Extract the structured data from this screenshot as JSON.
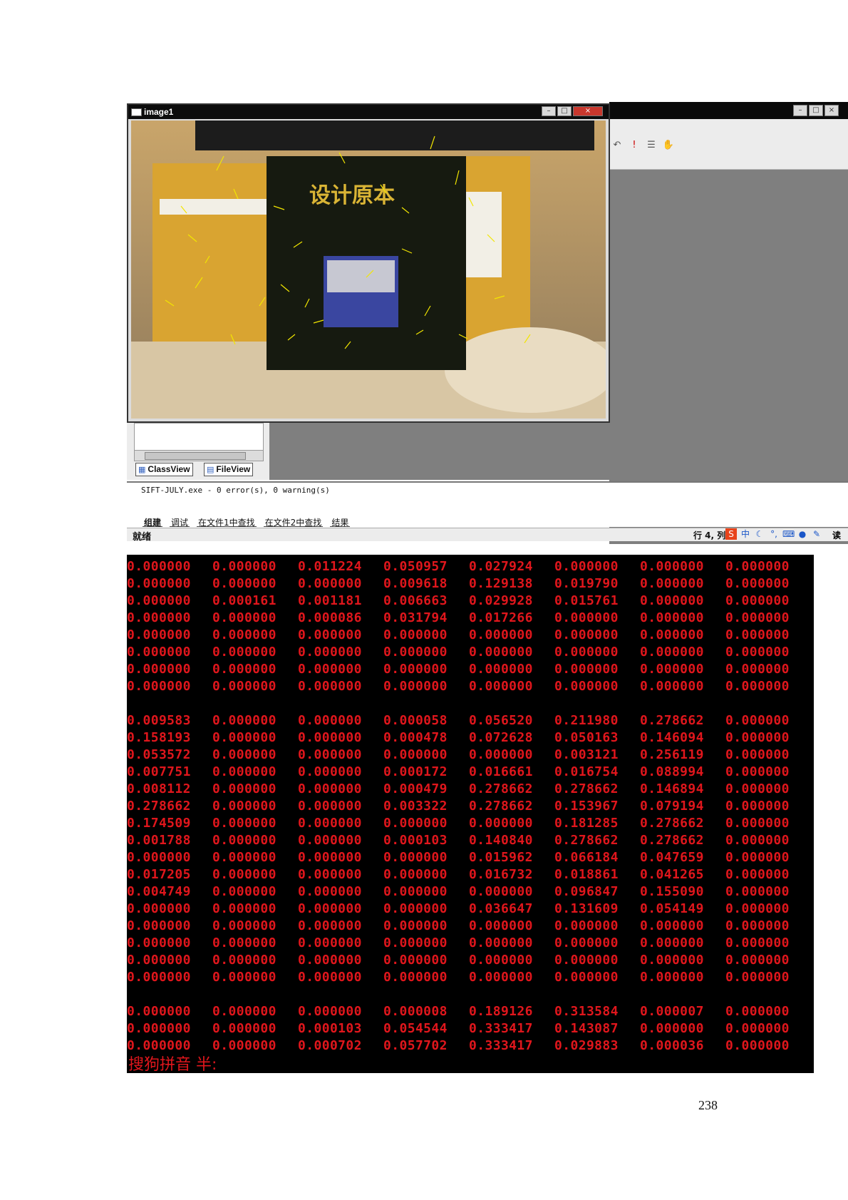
{
  "image_window": {
    "title": "image1"
  },
  "ide_window": {
    "toolbar_icons": [
      "undo-icon",
      "execute-icon",
      "list-icon",
      "hand-icon"
    ]
  },
  "workspace": {
    "tabs": [
      "ClassView",
      "FileView"
    ],
    "scroll_label": "III"
  },
  "output": {
    "text": "SIFT-JULY.exe - 0 error(s), 0 warning(s)",
    "tabs": [
      "组建",
      "调试",
      "在文件1中查找",
      "在文件2中查找",
      "结果"
    ]
  },
  "status": {
    "left": "就绪",
    "position": "行 4, 列",
    "right": "读"
  },
  "console": {
    "rows": [
      [
        "0.000000",
        "0.000000",
        "0.011224",
        "0.050957",
        "0.027924",
        "0.000000",
        "0.000000",
        "0.000000"
      ],
      [
        "0.000000",
        "0.000000",
        "0.000000",
        "0.009618",
        "0.129138",
        "0.019790",
        "0.000000",
        "0.000000"
      ],
      [
        "0.000000",
        "0.000161",
        "0.001181",
        "0.006663",
        "0.029928",
        "0.015761",
        "0.000000",
        "0.000000"
      ],
      [
        "0.000000",
        "0.000000",
        "0.000086",
        "0.031794",
        "0.017266",
        "0.000000",
        "0.000000",
        "0.000000"
      ],
      [
        "0.000000",
        "0.000000",
        "0.000000",
        "0.000000",
        "0.000000",
        "0.000000",
        "0.000000",
        "0.000000"
      ],
      [
        "0.000000",
        "0.000000",
        "0.000000",
        "0.000000",
        "0.000000",
        "0.000000",
        "0.000000",
        "0.000000"
      ],
      [
        "0.000000",
        "0.000000",
        "0.000000",
        "0.000000",
        "0.000000",
        "0.000000",
        "0.000000",
        "0.000000"
      ],
      [
        "0.000000",
        "0.000000",
        "0.000000",
        "0.000000",
        "0.000000",
        "0.000000",
        "0.000000",
        "0.000000"
      ],
      [],
      [
        "0.009583",
        "0.000000",
        "0.000000",
        "0.000058",
        "0.056520",
        "0.211980",
        "0.278662",
        "0.000000"
      ],
      [
        "0.158193",
        "0.000000",
        "0.000000",
        "0.000478",
        "0.072628",
        "0.050163",
        "0.146094",
        "0.000000"
      ],
      [
        "0.053572",
        "0.000000",
        "0.000000",
        "0.000000",
        "0.000000",
        "0.003121",
        "0.256119",
        "0.000000"
      ],
      [
        "0.007751",
        "0.000000",
        "0.000000",
        "0.000172",
        "0.016661",
        "0.016754",
        "0.088994",
        "0.000000"
      ],
      [
        "0.008112",
        "0.000000",
        "0.000000",
        "0.000479",
        "0.278662",
        "0.278662",
        "0.146894",
        "0.000000"
      ],
      [
        "0.278662",
        "0.000000",
        "0.000000",
        "0.003322",
        "0.278662",
        "0.153967",
        "0.079194",
        "0.000000"
      ],
      [
        "0.174509",
        "0.000000",
        "0.000000",
        "0.000000",
        "0.000000",
        "0.181285",
        "0.278662",
        "0.000000"
      ],
      [
        "0.001788",
        "0.000000",
        "0.000000",
        "0.000103",
        "0.140840",
        "0.278662",
        "0.278662",
        "0.000000"
      ],
      [
        "0.000000",
        "0.000000",
        "0.000000",
        "0.000000",
        "0.015962",
        "0.066184",
        "0.047659",
        "0.000000"
      ],
      [
        "0.017205",
        "0.000000",
        "0.000000",
        "0.000000",
        "0.016732",
        "0.018861",
        "0.041265",
        "0.000000"
      ],
      [
        "0.004749",
        "0.000000",
        "0.000000",
        "0.000000",
        "0.000000",
        "0.096847",
        "0.155090",
        "0.000000"
      ],
      [
        "0.000000",
        "0.000000",
        "0.000000",
        "0.000000",
        "0.036647",
        "0.131609",
        "0.054149",
        "0.000000"
      ],
      [
        "0.000000",
        "0.000000",
        "0.000000",
        "0.000000",
        "0.000000",
        "0.000000",
        "0.000000",
        "0.000000"
      ],
      [
        "0.000000",
        "0.000000",
        "0.000000",
        "0.000000",
        "0.000000",
        "0.000000",
        "0.000000",
        "0.000000"
      ],
      [
        "0.000000",
        "0.000000",
        "0.000000",
        "0.000000",
        "0.000000",
        "0.000000",
        "0.000000",
        "0.000000"
      ],
      [
        "0.000000",
        "0.000000",
        "0.000000",
        "0.000000",
        "0.000000",
        "0.000000",
        "0.000000",
        "0.000000"
      ],
      [],
      [
        "0.000000",
        "0.000000",
        "0.000000",
        "0.000008",
        "0.189126",
        "0.313584",
        "0.000007",
        "0.000000"
      ],
      [
        "0.000000",
        "0.000000",
        "0.000103",
        "0.054544",
        "0.333417",
        "0.143087",
        "0.000000",
        "0.000000"
      ],
      [
        "0.000000",
        "0.000000",
        "0.000702",
        "0.057702",
        "0.333417",
        "0.029883",
        "0.000036",
        "0.000000"
      ]
    ],
    "ime_prompt": "搜狗拼音 半:",
    "text_color": "#e0161c"
  },
  "page_number": "238"
}
